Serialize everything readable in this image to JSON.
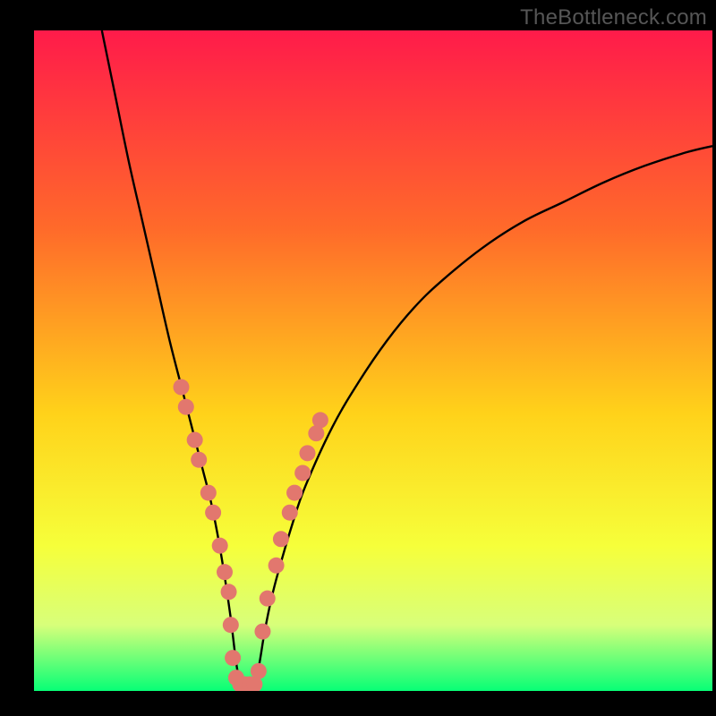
{
  "watermark": "TheBottleneck.com",
  "colors": {
    "gradient_top": "#ff1b4a",
    "gradient_mid_upper": "#ff6a2a",
    "gradient_mid": "#ffd21a",
    "gradient_mid_lower": "#f6ff3a",
    "gradient_lower": "#d8ff7a",
    "gradient_bottom": "#07ff76",
    "curve_stroke": "#000000",
    "dot_fill": "#e2776e",
    "dot_stroke": "#c7564f",
    "frame": "#000000"
  },
  "chart_data": {
    "type": "line",
    "title": "",
    "xlabel": "",
    "ylabel": "",
    "xlim": [
      0,
      100
    ],
    "ylim": [
      0,
      100
    ],
    "annotations": [],
    "series": [
      {
        "name": "curve",
        "x": [
          10,
          12,
          14,
          16,
          18,
          20,
          22,
          23,
          24,
          25,
          26,
          27,
          28,
          29,
          30,
          31,
          32,
          33,
          34,
          35,
          36,
          38,
          40,
          44,
          48,
          52,
          56,
          60,
          66,
          72,
          78,
          84,
          90,
          96,
          100
        ],
        "values": [
          100,
          90,
          80,
          71,
          62,
          53,
          45,
          41,
          37,
          33,
          29,
          24,
          18,
          11,
          3,
          0,
          0,
          3,
          9,
          14,
          18,
          25,
          31,
          40,
          47,
          53,
          58,
          62,
          67,
          71,
          74,
          77,
          79.5,
          81.5,
          82.5
        ]
      }
    ],
    "dots": [
      {
        "x": 21.7,
        "y": 46
      },
      {
        "x": 22.4,
        "y": 43
      },
      {
        "x": 23.7,
        "y": 38
      },
      {
        "x": 24.3,
        "y": 35
      },
      {
        "x": 25.7,
        "y": 30
      },
      {
        "x": 26.4,
        "y": 27
      },
      {
        "x": 27.4,
        "y": 22
      },
      {
        "x": 28.1,
        "y": 18
      },
      {
        "x": 28.7,
        "y": 15
      },
      {
        "x": 29.0,
        "y": 10
      },
      {
        "x": 29.3,
        "y": 5
      },
      {
        "x": 29.8,
        "y": 2
      },
      {
        "x": 30.4,
        "y": 1
      },
      {
        "x": 31.1,
        "y": 1
      },
      {
        "x": 31.8,
        "y": 1
      },
      {
        "x": 32.5,
        "y": 1
      },
      {
        "x": 33.1,
        "y": 3
      },
      {
        "x": 33.7,
        "y": 9
      },
      {
        "x": 34.4,
        "y": 14
      },
      {
        "x": 35.7,
        "y": 19
      },
      {
        "x": 36.4,
        "y": 23
      },
      {
        "x": 37.7,
        "y": 27
      },
      {
        "x": 38.4,
        "y": 30
      },
      {
        "x": 39.6,
        "y": 33
      },
      {
        "x": 40.3,
        "y": 36
      },
      {
        "x": 41.6,
        "y": 39
      },
      {
        "x": 42.2,
        "y": 41
      }
    ]
  }
}
